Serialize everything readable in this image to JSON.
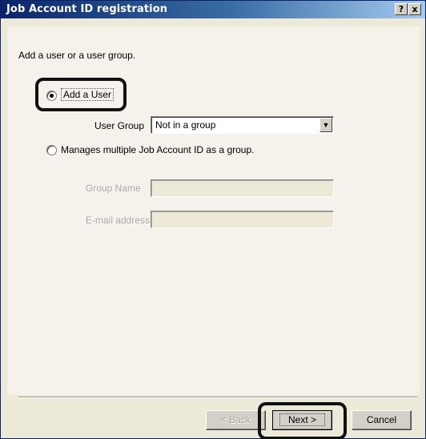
{
  "window": {
    "title": "Job Account ID registration",
    "help_label": "?",
    "close_label": "x"
  },
  "instruction": "Add a user or a user group.",
  "options": {
    "add_user": {
      "label": "Add a User",
      "selected": true
    },
    "multiple": {
      "label": "Manages multiple Job Account ID as a group.",
      "selected": false
    }
  },
  "user_group": {
    "label": "User Group",
    "value": "Not in a group"
  },
  "group_name": {
    "label": "Group Name",
    "value": ""
  },
  "email": {
    "label": "E-mail address",
    "value": ""
  },
  "buttons": {
    "back": "< Back",
    "next": "Next >",
    "cancel": "Cancel"
  },
  "icons": {
    "dropdown": "chevron-down-icon"
  }
}
